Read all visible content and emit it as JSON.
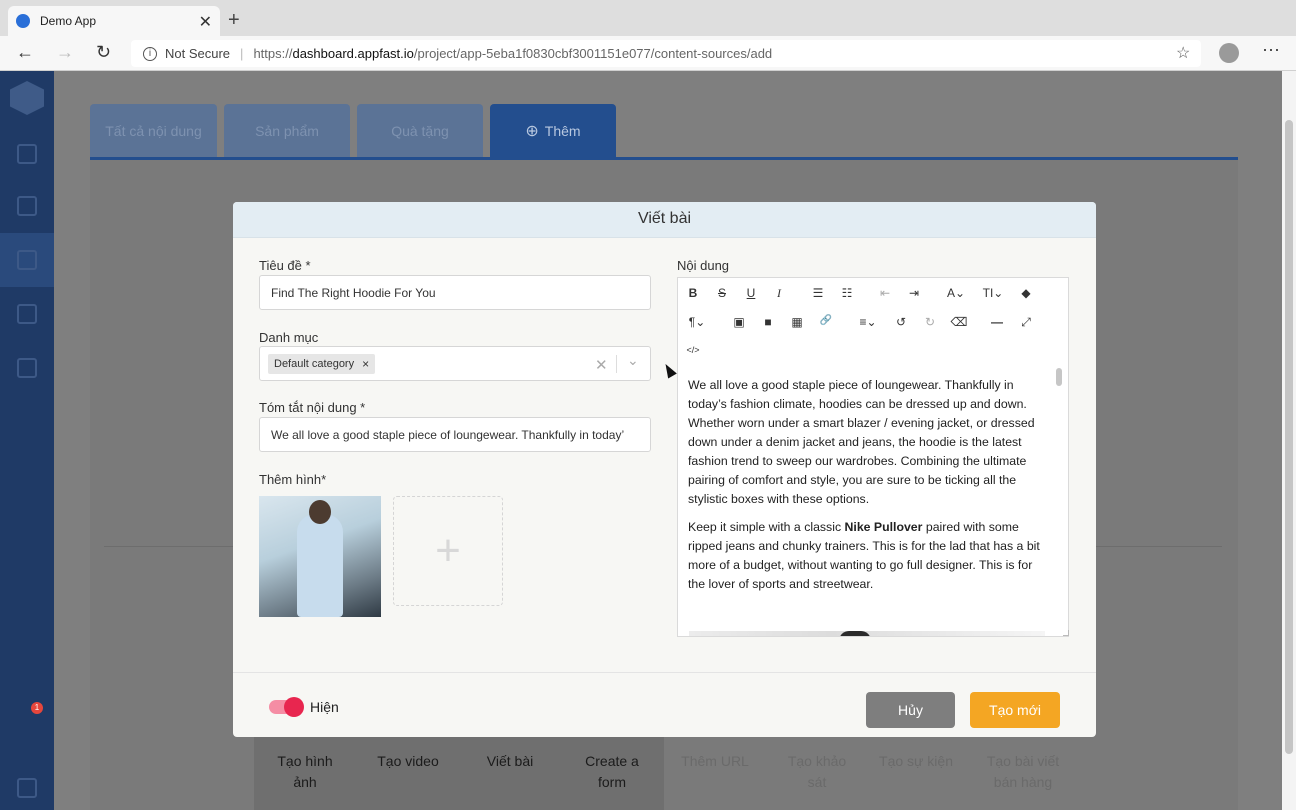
{
  "browser": {
    "tab_title": "Demo App",
    "tab_close": "✕",
    "new_tab": "+",
    "back": "←",
    "forward": "→",
    "reload": "↻",
    "security_label": "Not Secure",
    "security_sep": "|",
    "url_prefix": "https://",
    "url_host": "dashboard.appfast.io",
    "url_path": "/project/app-5eba1f0830cbf3001151e077/content-sources/add",
    "star": "☆",
    "menu": "⋯"
  },
  "sidebar": {
    "items": [
      "apps-icon",
      "desktop-icon",
      "content-icon",
      "notification-icon",
      "settings-icon"
    ],
    "active_index": 2,
    "badge_count": "1"
  },
  "background": {
    "tabs": [
      "Tất cả nội dung",
      "Sản phẩm",
      "Quà tặng",
      "Thêm"
    ],
    "add_tab_icon": "⊕",
    "options": [
      "Tạo hình ảnh",
      "Tạo video",
      "Viết bài",
      "Create a form",
      "Thêm URL",
      "Tạo khảo sát",
      "Tạo sự kiện",
      "Tạo bài viết bán hàng"
    ]
  },
  "modal": {
    "title": "Viết bài",
    "title_label": "Tiêu đề *",
    "title_value": "Find The Right Hoodie For You",
    "category_label": "Danh mục",
    "category_chip": "Default category",
    "category_chip_remove": "×",
    "category_clear": "✕",
    "category_arrow": "⌄",
    "summary_label": "Tóm tắt nội dung *",
    "summary_value": "We all love a good staple piece of loungewear. Thankfully in today’",
    "image_label": "Thêm hình*",
    "add_image_icon": "+",
    "content_label": "Nội dung",
    "toolbar": {
      "bold": "B",
      "strike": "S",
      "underline": "U",
      "italic": "I",
      "ul": "☰",
      "ol": "☷",
      "outdent": "⇤",
      "indent": "⇥",
      "font_color": "A⌄",
      "font_size": "TI⌄",
      "highlight": "◆",
      "paragraph": "¶⌄",
      "image": "▣",
      "video": "■",
      "table": "▦",
      "link": "🔗",
      "align": "≡⌄",
      "undo": "↺",
      "redo": "↻",
      "eraser": "⌫",
      "hr": "—",
      "fullscreen": "⤢",
      "code": "</>"
    },
    "editor_paragraph_1": "We all love a good staple piece of loungewear. Thankfully in today’s fashion climate, hoodies can be dressed up and down. Whether worn under a smart blazer / evening jacket, or dressed down under a denim jacket and jeans, the hoodie is the latest fashion trend to sweep our wardrobes. Combining the ultimate pairing of comfort and style, you are sure to be ticking all the stylistic boxes with these options.",
    "editor_paragraph_2_before": "Keep it simple with a classic ",
    "editor_paragraph_2_bold": "Nike Pullover",
    "editor_paragraph_2_after": " paired with some ripped jeans and chunky trainers. This is for the lad that has a bit more of a budget, without wanting to go full designer. This is for the lover of sports and streetwear.",
    "visibility_label": "Hiện",
    "visibility_on": true,
    "cancel_label": "Hủy",
    "create_label": "Tạo mới"
  }
}
